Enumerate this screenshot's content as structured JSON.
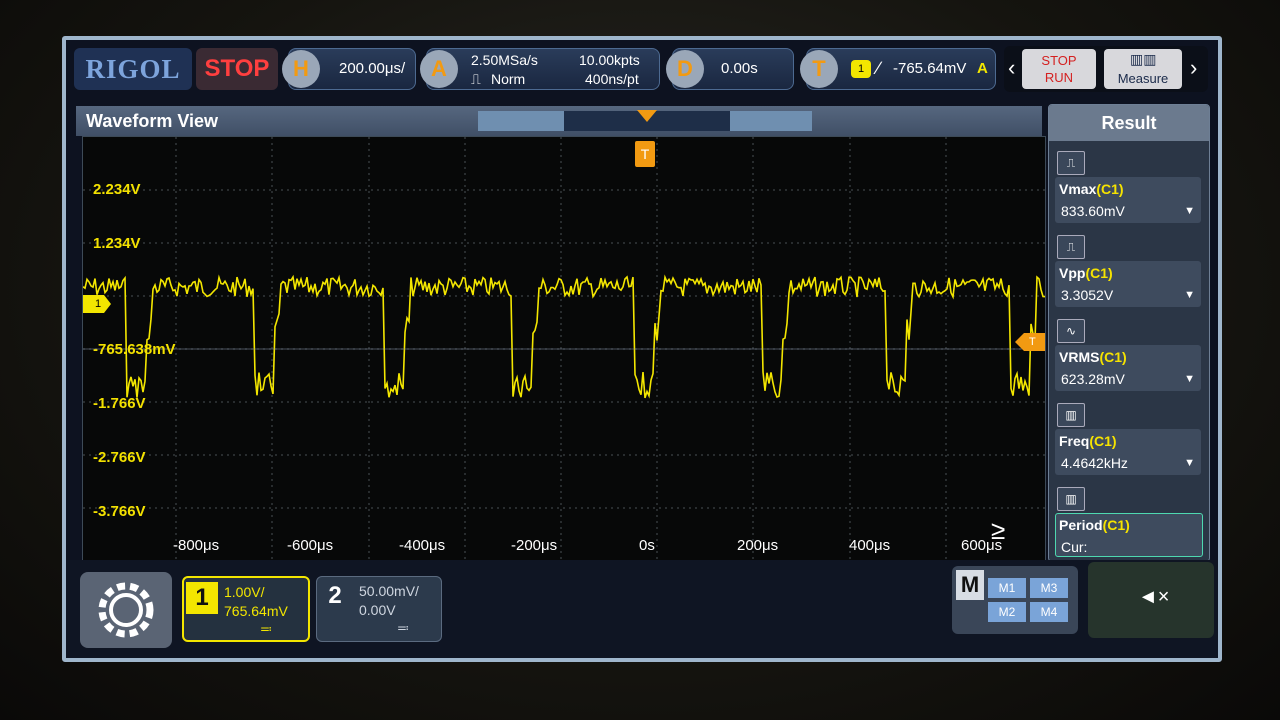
{
  "brand": "RIGOL",
  "run_status": "STOP",
  "horizontal": {
    "badge": "H",
    "timebase": "200.00μs/"
  },
  "acquire": {
    "badge": "A",
    "sample_rate": "2.50MSa/s",
    "mode": "Norm",
    "mem_depth": "10.00kpts",
    "sample_period": "400ns/pt"
  },
  "delay": {
    "badge": "D",
    "value": "0.00s"
  },
  "trigger": {
    "badge": "T",
    "source": "1",
    "level": "-765.64mV",
    "sweep": "A"
  },
  "buttons": {
    "stop_label": "STOP",
    "run_label": "RUN",
    "measure_label": "Measure",
    "prev": "‹",
    "next": "›"
  },
  "waveform_view": {
    "title": "Waveform View",
    "trigger_marker": "T"
  },
  "y_labels": [
    "2.234V",
    "1.234V",
    "-765.638mV",
    "-1.766V",
    "-2.766V",
    "-3.766V"
  ],
  "x_labels": [
    "-800μs",
    "-600μs",
    "-400μs",
    "-200μs",
    "0s",
    "200μs",
    "400μs",
    "600μs"
  ],
  "channel_marker": "1",
  "results": {
    "title": "Result",
    "items": [
      {
        "name": "Vmax",
        "src": "(C1)",
        "value": "833.60mV"
      },
      {
        "name": "Vpp",
        "src": "(C1)",
        "value": "3.3052V"
      },
      {
        "name": "VRMS",
        "src": "(C1)",
        "value": "623.28mV"
      },
      {
        "name": "Freq",
        "src": "(C1)",
        "value": "4.4642kHz"
      },
      {
        "name": "Period",
        "src": "(C1)",
        "value": "Cur:"
      }
    ]
  },
  "channels": [
    {
      "num": "1",
      "scale": "1.00V/",
      "offset": "765.64mV"
    },
    {
      "num": "2",
      "scale": "50.00mV/",
      "offset": "0.00V"
    }
  ],
  "math": {
    "label": "M",
    "m1": "M1",
    "m2": "M2",
    "m3": "M3",
    "m4": "M4"
  },
  "colors": {
    "ch1": "#f3e600",
    "trigger": "#f29a12",
    "stop": "#ff3f3f"
  }
}
